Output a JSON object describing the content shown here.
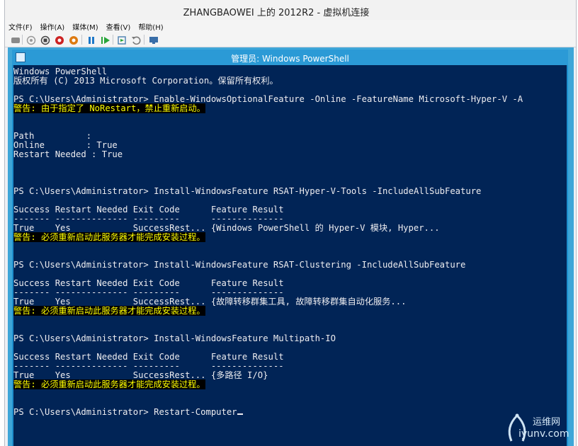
{
  "vm_window": {
    "title": "ZHANGBAOWEI 上的 2012R2 - 虚拟机连接"
  },
  "menu": {
    "items": [
      {
        "label": "文件(F)"
      },
      {
        "label": "操作(A)"
      },
      {
        "label": "媒体(M)"
      },
      {
        "label": "查看(V)"
      },
      {
        "label": "帮助(H)"
      }
    ]
  },
  "toolbar": {
    "buttons": [
      {
        "name": "ctrl-alt-del-icon",
        "color": "#8a8a8a"
      },
      {
        "name": "start-icon",
        "color": "#9a9a9a"
      },
      {
        "name": "turn-off-icon",
        "color": "#444444"
      },
      {
        "name": "shutdown-icon",
        "color": "#cc2222"
      },
      {
        "name": "save-icon",
        "color": "#dd7a11"
      },
      {
        "name": "pause-icon",
        "color": "#1e78c8"
      },
      {
        "name": "resume-icon",
        "color": "#29a53a"
      },
      {
        "name": "snapshot-icon",
        "color": "#4a7fb0"
      },
      {
        "name": "revert-icon",
        "color": "#7a7a7a"
      },
      {
        "name": "enhanced-session-icon",
        "color": "#3a6ea8"
      }
    ]
  },
  "powershell": {
    "title": "管理员: Windows PowerShell",
    "console_bg": "#012456",
    "warning_color": "#ffff00",
    "lines": [
      {
        "text": "Windows PowerShell",
        "warn": false
      },
      {
        "text": "版权所有 (C) 2013 Microsoft Corporation。保留所有权利。",
        "warn": false
      },
      {
        "text": "",
        "warn": false
      },
      {
        "text": "PS C:\\Users\\Administrator> Enable-WindowsOptionalFeature -Online -FeatureName Microsoft-Hyper-V -A",
        "warn": false
      },
      {
        "text": "警告: 由于指定了 NoRestart，禁止重新启动。",
        "warn": true
      },
      {
        "text": "",
        "warn": false
      },
      {
        "text": "",
        "warn": false
      },
      {
        "text": "Path          :",
        "warn": false
      },
      {
        "text": "Online        : True",
        "warn": false
      },
      {
        "text": "Restart Needed : True",
        "warn": false
      },
      {
        "text": "",
        "warn": false
      },
      {
        "text": "",
        "warn": false
      },
      {
        "text": "",
        "warn": false
      },
      {
        "text": "PS C:\\Users\\Administrator> Install-WindowsFeature RSAT-Hyper-V-Tools -IncludeAllSubFeature",
        "warn": false
      },
      {
        "text": "",
        "warn": false
      },
      {
        "text": "Success Restart Needed Exit Code      Feature Result",
        "warn": false
      },
      {
        "text": "------- -------------- ---------      --------------",
        "warn": false
      },
      {
        "text": "True    Yes            SuccessRest... {Windows PowerShell 的 Hyper-V 模块, Hyper...",
        "warn": false
      },
      {
        "text": "警告: 必须重新启动此服务器才能完成安装过程。",
        "warn": true
      },
      {
        "text": "",
        "warn": false
      },
      {
        "text": "",
        "warn": false
      },
      {
        "text": "PS C:\\Users\\Administrator> Install-WindowsFeature RSAT-Clustering -IncludeAllSubFeature",
        "warn": false
      },
      {
        "text": "",
        "warn": false
      },
      {
        "text": "Success Restart Needed Exit Code      Feature Result",
        "warn": false
      },
      {
        "text": "------- -------------- ---------      --------------",
        "warn": false
      },
      {
        "text": "True    Yes            SuccessRest... {故障转移群集工具, 故障转移群集自动化服务...",
        "warn": false
      },
      {
        "text": "警告: 必须重新启动此服务器才能完成安装过程。",
        "warn": true
      },
      {
        "text": "",
        "warn": false
      },
      {
        "text": "",
        "warn": false
      },
      {
        "text": "PS C:\\Users\\Administrator> Install-WindowsFeature Multipath-IO",
        "warn": false
      },
      {
        "text": "",
        "warn": false
      },
      {
        "text": "Success Restart Needed Exit Code      Feature Result",
        "warn": false
      },
      {
        "text": "------- -------------- ---------      --------------",
        "warn": false
      },
      {
        "text": "True    Yes            SuccessRest... {多路径 I/O}",
        "warn": false
      },
      {
        "text": "警告: 必须重新启动此服务器才能完成安装过程。",
        "warn": true
      },
      {
        "text": "",
        "warn": false
      },
      {
        "text": "",
        "warn": false
      },
      {
        "text": "PS C:\\Users\\Administrator> Restart-Computer",
        "warn": false
      }
    ]
  },
  "watermark": {
    "cn": "运维网",
    "en": "iyunv.com"
  }
}
